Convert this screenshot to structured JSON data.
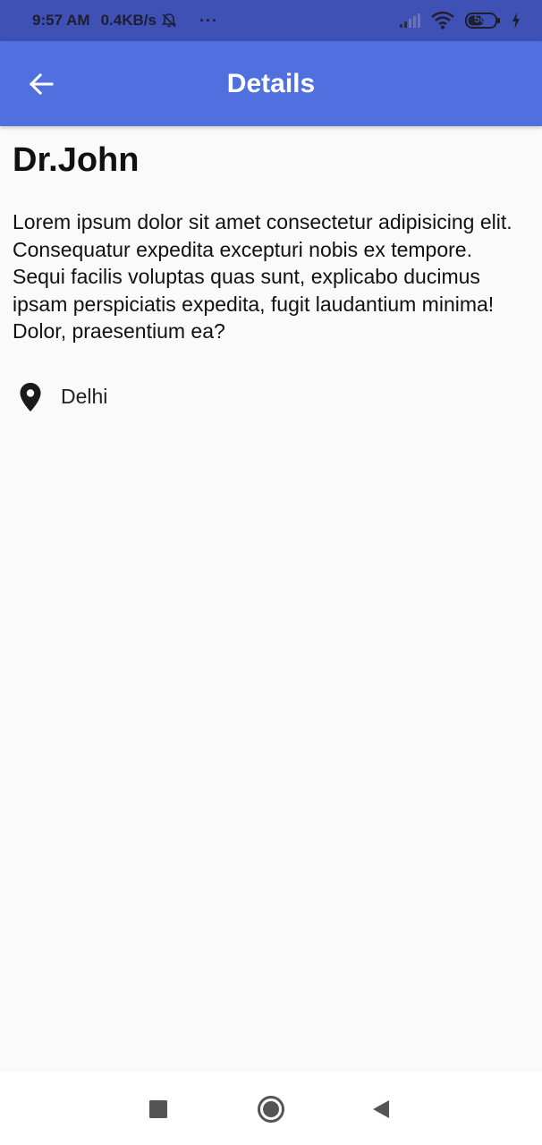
{
  "status_bar": {
    "time": "9:57 AM",
    "speed": "0.4KB/s",
    "more": "···",
    "battery": "58",
    "icons": [
      "muted-bell-icon",
      "signal-icon",
      "wifi-icon",
      "battery-icon",
      "charging-icon"
    ]
  },
  "app_bar": {
    "title": "Details",
    "back_icon": "arrow-back-icon"
  },
  "details": {
    "name": "Dr.John",
    "description": "Lorem ipsum dolor sit amet consectetur adipisicing elit. Consequatur expedita excepturi nobis ex tempore. Sequi facilis voluptas quas sunt, explicabo ducimus ipsam perspiciatis expedita, fugit laudantium minima! Dolor, praesentium ea?",
    "location": "Delhi",
    "location_icon": "location-pin-icon"
  },
  "nav_bar": {
    "icons": [
      "recents-square-icon",
      "home-circle-icon",
      "back-triangle-icon"
    ]
  },
  "colors": {
    "status_bar": "#3f51b5",
    "app_bar": "#5170e0",
    "background": "#fafafa"
  }
}
